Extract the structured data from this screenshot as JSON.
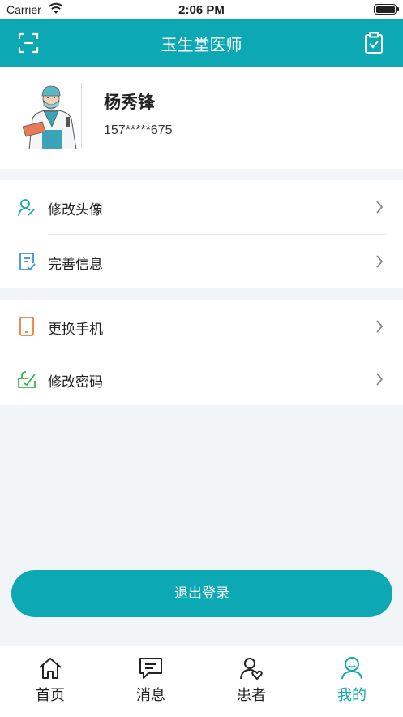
{
  "status_bar": {
    "carrier": "Carrier",
    "time": "2:06 PM"
  },
  "header": {
    "title": "玉生堂医师",
    "left_icon": "scan-icon",
    "right_icon": "clipboard-check-icon"
  },
  "profile": {
    "name": "杨秀锋",
    "phone": "157*****675"
  },
  "menu": {
    "group1": [
      {
        "label": "修改头像",
        "icon": "user-edit-icon",
        "icon_color": "#17a6b0"
      },
      {
        "label": "完善信息",
        "icon": "document-check-icon",
        "icon_color": "#3a8fe0"
      }
    ],
    "group2": [
      {
        "label": "更换手机",
        "icon": "phone-icon",
        "icon_color": "#f07a3c"
      },
      {
        "label": "修改密码",
        "icon": "lock-edit-icon",
        "icon_color": "#3ab54a"
      }
    ]
  },
  "logout_label": "退出登录",
  "tabs": [
    {
      "label": "首页",
      "icon": "home-icon"
    },
    {
      "label": "消息",
      "icon": "message-icon"
    },
    {
      "label": "患者",
      "icon": "patient-icon"
    },
    {
      "label": "我的",
      "icon": "me-icon",
      "active": true
    }
  ],
  "colors": {
    "primary": "#0ca8b4",
    "background": "#f2f5f7"
  }
}
